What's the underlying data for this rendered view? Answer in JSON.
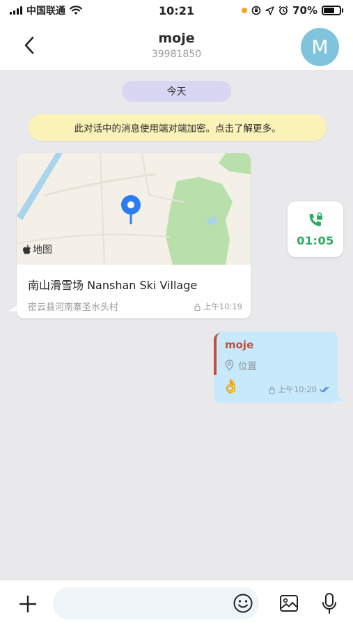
{
  "status_bar": {
    "carrier": "中国联通",
    "time": "10:21",
    "battery": "70%",
    "icons": [
      "signal-icon",
      "wifi-icon",
      "orange-dot",
      "lock-rotation-icon",
      "location-arrow-icon",
      "alarm-icon",
      "battery-icon"
    ]
  },
  "header": {
    "title": "moje",
    "subtitle": "39981850",
    "avatar_letter": "M",
    "avatar_color": "#7fc4dc"
  },
  "chat": {
    "date_label": "今天",
    "encryption_notice": "此对话中的消息使用端对端加密。点击了解更多。",
    "location_message": {
      "map_label": "地图",
      "place_name": "南山滑雪场 Nanshan Ski Village",
      "address": "密云县河南寨圣水头村",
      "time": "上午10:19"
    },
    "call": {
      "duration": "01:05",
      "icon": "phone-lock-icon",
      "accent": "#2bab5f"
    },
    "outgoing_message": {
      "reply_author": "moje",
      "reply_type": "位置",
      "content": "👌",
      "time": "上午10:20",
      "status": "read"
    }
  },
  "input_bar": {
    "placeholder": ""
  },
  "colors": {
    "background": "#e9e9eb",
    "outgoing_bubble": "#c8e8fb",
    "reply_accent": "#c0503d",
    "date_pill": "#d9d6f3",
    "notice_bg": "#fbf2b8"
  }
}
